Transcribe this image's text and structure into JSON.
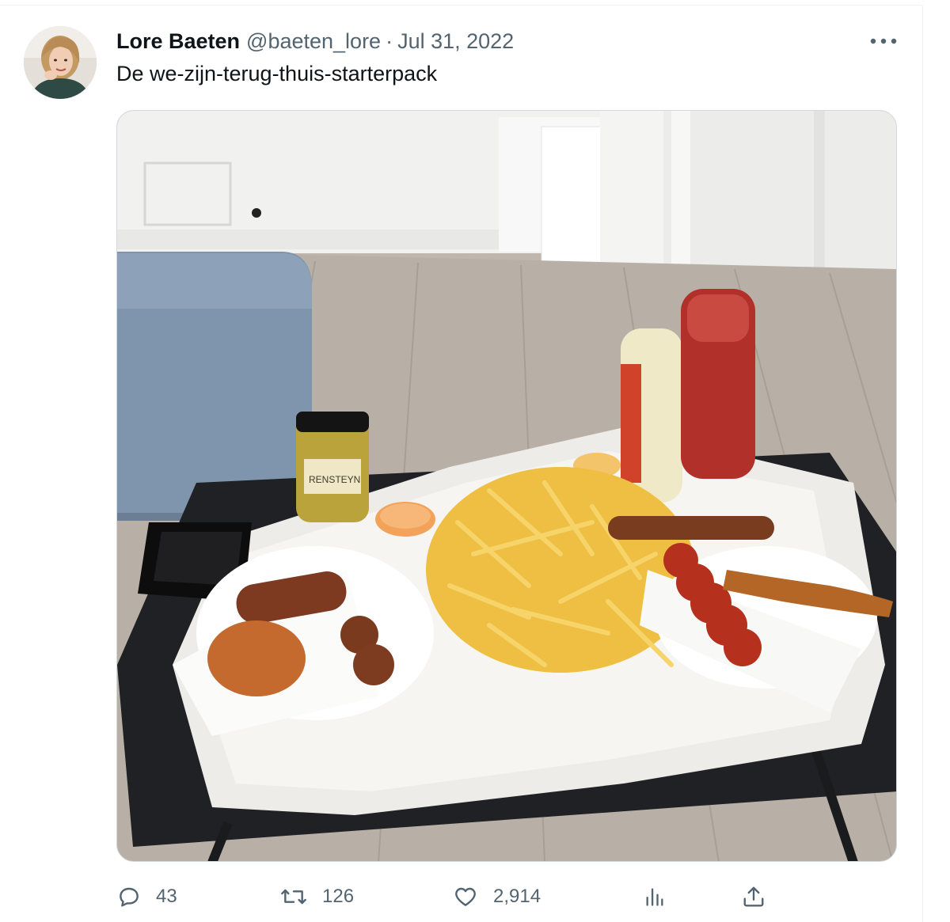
{
  "tweet": {
    "author_name": "Lore Baeten",
    "handle": "@baeten_lore",
    "separator": "·",
    "date": "Jul 31, 2022",
    "text": "De we-zijn-terug-thuis-starterpack",
    "photo_label_jar": "RENSTEYN"
  },
  "actions": {
    "replies": "43",
    "retweets": "126",
    "likes": "2,914"
  },
  "icons": {
    "more": "more-icon",
    "reply": "reply-icon",
    "retweet": "retweet-icon",
    "like": "heart-icon",
    "views": "views-icon",
    "share": "share-icon"
  },
  "colors": {
    "text_primary": "#0f1419",
    "text_secondary": "#536471",
    "border": "#cfd9de"
  }
}
